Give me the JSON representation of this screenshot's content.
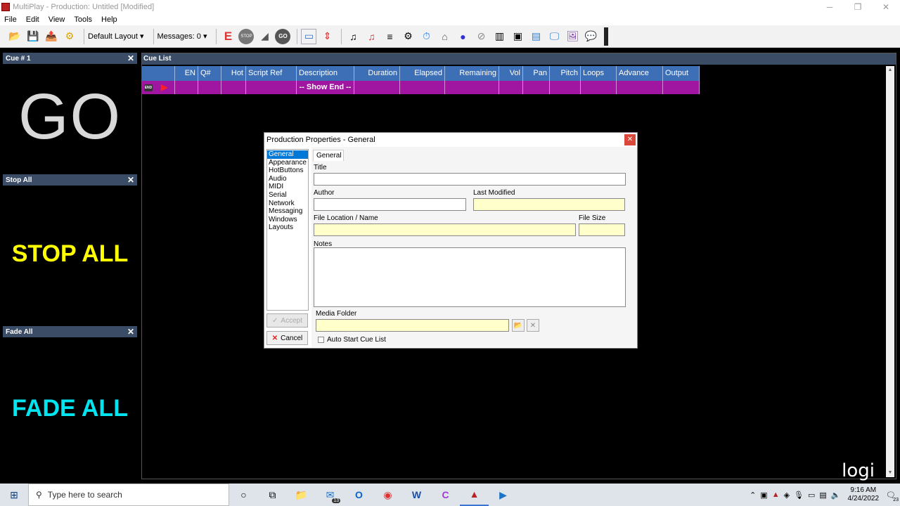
{
  "window": {
    "title": "MultiPlay - Production: Untitled [Modified]"
  },
  "menu": [
    "File",
    "Edit",
    "View",
    "Tools",
    "Help"
  ],
  "toolbar": {
    "layout_dropdown": "Default Layout",
    "messages": "Messages: 0"
  },
  "panels": {
    "cue": {
      "title": "Cue # 1",
      "big_text": "GO"
    },
    "stop": {
      "title": "Stop All",
      "big_text": "STOP ALL"
    },
    "fade": {
      "title": "Fade All",
      "big_text": "FADE ALL"
    }
  },
  "cuelist": {
    "title": "Cue List",
    "columns": [
      "",
      "EN",
      "Q#",
      "Hot",
      "Script Ref",
      "Description",
      "Duration",
      "Elapsed",
      "Remaining",
      "Vol",
      "Pan",
      "Pitch",
      "Loops",
      "Advance",
      "Output"
    ],
    "rows": [
      {
        "description": "-- Show End --"
      }
    ]
  },
  "dialog": {
    "title": "Production Properties - General",
    "categories": [
      "General",
      "Appearance",
      "HotButtons",
      "Audio",
      "MIDI",
      "Serial",
      "Network",
      "Messaging",
      "Windows",
      "Layouts"
    ],
    "selected_category": "General",
    "tab": "General",
    "labels": {
      "title": "Title",
      "author": "Author",
      "last_modified": "Last Modified",
      "file_location": "File Location / Name",
      "file_size": "File Size",
      "notes": "Notes",
      "media_folder": "Media Folder",
      "auto_start": "Auto Start Cue List"
    },
    "values": {
      "title": "",
      "author": "",
      "last_modified": "",
      "file_location": "",
      "file_size": "",
      "notes": "",
      "media_folder": ""
    },
    "buttons": {
      "accept": "Accept",
      "cancel": "Cancel"
    }
  },
  "watermark": "logi",
  "taskbar": {
    "search_placeholder": "Type here to search",
    "mail_badge": "13",
    "time": "9:16 AM",
    "date": "4/24/2022",
    "notifications": "23"
  },
  "colors": {
    "panel_header": "#3b4c66",
    "grid_header": "#3d6fb6",
    "show_end_row": "#a016a0",
    "go_text": "#d9d9d9",
    "stop_text": "#ffff00",
    "fade_text": "#00e5f0",
    "readonly_field": "#ffffcc"
  }
}
